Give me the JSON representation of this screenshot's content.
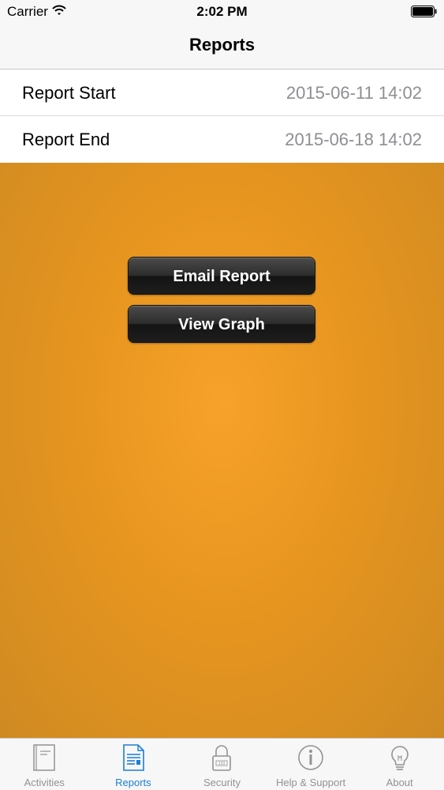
{
  "status_bar": {
    "carrier": "Carrier",
    "time": "2:02 PM",
    "wifi_icon": "wifi-icon",
    "battery_icon": "battery-icon"
  },
  "nav": {
    "title": "Reports"
  },
  "rows": [
    {
      "label": "Report Start",
      "value": "2015-06-11 14:02"
    },
    {
      "label": "Report End",
      "value": "2015-06-18 14:02"
    }
  ],
  "actions": {
    "email_label": "Email Report",
    "graph_label": "View Graph"
  },
  "tabs": [
    {
      "label": "Activities",
      "icon": "notebook-icon",
      "active": false
    },
    {
      "label": "Reports",
      "icon": "document-icon",
      "active": true
    },
    {
      "label": "Security",
      "icon": "lock-icon",
      "active": false
    },
    {
      "label": "Help & Support",
      "icon": "info-icon",
      "active": false
    },
    {
      "label": "About",
      "icon": "lightbulb-icon",
      "active": false
    }
  ],
  "colors": {
    "accent": "#1a7fd6",
    "background": "#e6951f",
    "button": "#1d1d1d"
  }
}
